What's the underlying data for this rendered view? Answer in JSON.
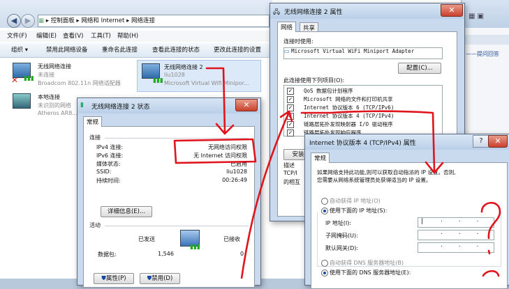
{
  "explorer": {
    "breadcrumb": [
      "控制面板",
      "网络和 Internet",
      "网络连接"
    ],
    "menu": [
      "文件(F)",
      "编辑(E)",
      "查看(V)",
      "工具(T)",
      "帮助(H)"
    ],
    "toolbar": [
      "组织",
      "禁用此网络设备",
      "重命名此连接",
      "查看此连接的状态",
      "更改此连接的设置"
    ],
    "connections": [
      {
        "name": "无线网络连接",
        "status": "未连接",
        "device": "Broadcom 802.11n 网络适配器"
      },
      {
        "name": "无线网络连接 2",
        "status": "liu1028",
        "device": "Microsoft Virtual Wifi Minipor..."
      },
      {
        "name": "本地连接",
        "status": "未识别的网络",
        "device": "Atheros AR8..."
      }
    ]
  },
  "right_strip": {
    "link": "提问回答"
  },
  "status_dialog": {
    "title": "无线网络连接 2 状态",
    "tab": "常规",
    "section_connection": "连接",
    "rows": [
      {
        "label": "IPv4 连接:",
        "value": "无网络访问权限"
      },
      {
        "label": "IPv6 连接:",
        "value": "无 Internet 访问权限"
      },
      {
        "label": "媒体状态:",
        "value": "已启用"
      },
      {
        "label": "SSID:",
        "value": "liu1028"
      },
      {
        "label": "持续时间:",
        "value": "00:26:49"
      }
    ],
    "details_button": "详细信息(E)...",
    "section_activity": "活动",
    "sent_label": "已发送",
    "received_label": "已接收",
    "packets_label": "数据包:",
    "packets_sent": "1,546",
    "packets_received": "0",
    "properties_button": "属性(P)",
    "disable_button": "禁用(D)"
  },
  "props_dialog": {
    "title": "无线网络连接 2 属性",
    "tabs": [
      "网络",
      "共享"
    ],
    "connect_using": "连接时使用:",
    "adapter": "Microsoft Virtual WiFi Miniport Adapter",
    "configure_button": "配置(C)...",
    "items_label": "此连接使用下列项目(O):",
    "items": [
      "QoS 数据包计划程序",
      "Microsoft 网络的文件和打印机共享",
      "Internet 协议版本 6 (TCP/IPv6)",
      "Internet 协议版本 4 (TCP/IPv4)",
      "链路层拓扑发现映射器 I/O 驱动程序",
      "链路层拓扑发现响应程序"
    ],
    "install_button": "安装",
    "desc_label": "描述",
    "desc_text": [
      "TCP/I",
      "的相互"
    ]
  },
  "ipv4_dialog": {
    "title": "Internet 协议版本 4 (TCP/IPv4) 属性",
    "tab": "常规",
    "intro": [
      "如果网络支持此功能,则可以获取自动指派的 IP 设置。否则,",
      "您需要从网络系统管理员处获得适当的 IP 设置。"
    ],
    "auto_ip": "自动获得 IP 地址(O)",
    "use_ip": "使用下面的 IP 地址(S):",
    "ip_label": "IP 地址(I):",
    "mask_label": "子网掩码(U):",
    "gateway_label": "默认网关(D):",
    "auto_dns": "自动获得 DNS 服务器地址(B)",
    "use_dns": "使用下面的 DNS 服务器地址(E):"
  },
  "colors": {
    "annotation": "#e0141c",
    "titlebar": "#c8dbef",
    "accent": "#1a4aa0"
  }
}
